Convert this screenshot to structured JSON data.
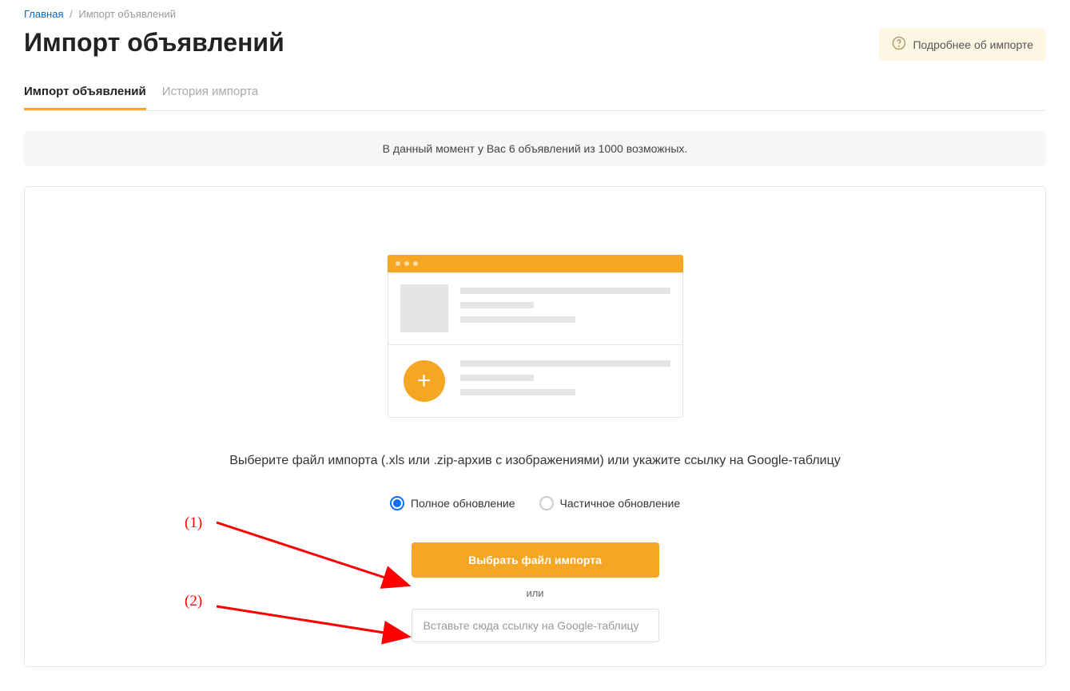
{
  "breadcrumb": {
    "home": "Главная",
    "current": "Импорт объявлений"
  },
  "page_title": "Импорт объявлений",
  "help_chip": "Подробнее об импорте",
  "tabs": {
    "import": "Импорт объявлений",
    "history": "История импорта"
  },
  "notice": "В данный момент у Вас 6 объявлений из 1000 возможных.",
  "instruction": "Выберите файл импорта (.xls или .zip-архив с изображениями) или укажите ссылку на Google-таблицу",
  "radio": {
    "full": "Полное обновление",
    "partial": "Частичное обновление"
  },
  "upload_button": "Выбрать файл импорта",
  "or": "или",
  "link_placeholder": "Вставьте сюда ссылку на Google-таблицу",
  "annotations": {
    "one": "(1)",
    "two": "(2)"
  }
}
